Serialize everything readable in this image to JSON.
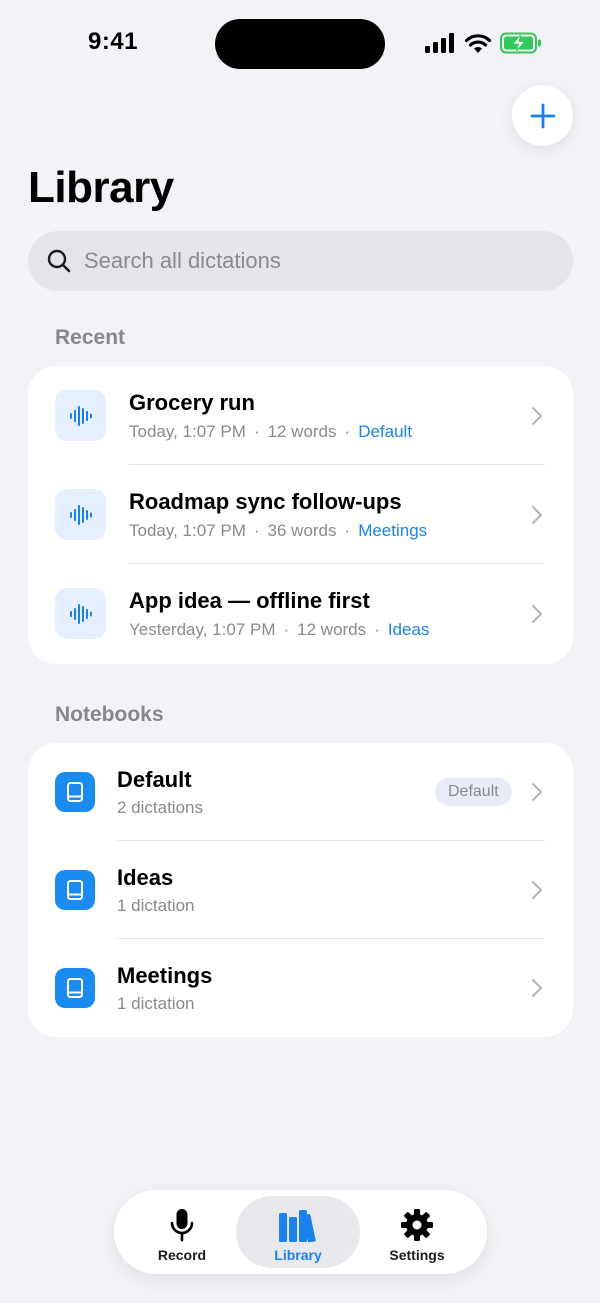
{
  "status_bar": {
    "time": "9:41"
  },
  "header": {
    "title": "Library",
    "add_icon": "plus-icon"
  },
  "search": {
    "placeholder": "Search all dictations",
    "value": ""
  },
  "recent": {
    "header": "Recent",
    "items": [
      {
        "title": "Grocery run",
        "date": "Today, 1:07 PM",
        "words": "12 words",
        "notebook": "Default",
        "icon": "waveform-icon"
      },
      {
        "title": "Roadmap sync follow-ups",
        "date": "Today, 1:07 PM",
        "words": "36 words",
        "notebook": "Meetings",
        "icon": "waveform-icon"
      },
      {
        "title": "App idea — offline first",
        "date": "Yesterday, 1:07 PM",
        "words": "12 words",
        "notebook": "Ideas",
        "icon": "waveform-icon"
      }
    ]
  },
  "notebooks": {
    "header": "Notebooks",
    "items": [
      {
        "name": "Default",
        "count": "2 dictations",
        "badge": "Default",
        "icon": "book-icon"
      },
      {
        "name": "Ideas",
        "count": "1 dictation",
        "icon": "book-icon"
      },
      {
        "name": "Meetings",
        "count": "1 dictation",
        "icon": "book-icon"
      }
    ]
  },
  "tab_bar": {
    "tabs": [
      {
        "label": "Record",
        "icon": "microphone-icon",
        "active": false
      },
      {
        "label": "Library",
        "icon": "books-icon",
        "active": true
      },
      {
        "label": "Settings",
        "icon": "gear-icon",
        "active": false
      }
    ]
  },
  "colors": {
    "accent": "#1a82e8",
    "background": "#f2f2f7",
    "battery": "#34c759"
  }
}
